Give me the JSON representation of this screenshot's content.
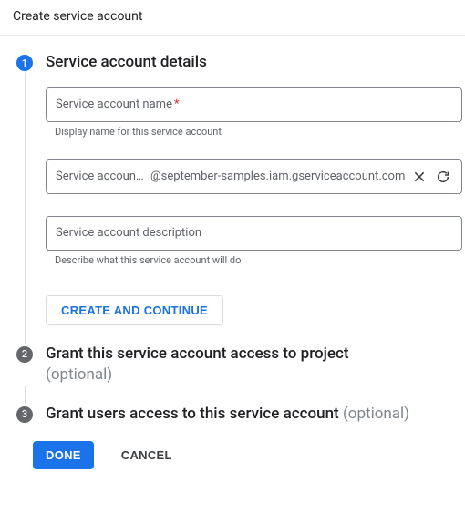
{
  "header": {
    "title": "Create service account"
  },
  "steps": {
    "s1": {
      "num": "1",
      "title": "Service account details",
      "name_field": {
        "label": "Service account name",
        "helper": "Display name for this service account"
      },
      "id_field": {
        "label": "Service account I...",
        "domain": "@september-samples.iam.gserviceaccount.com"
      },
      "desc_field": {
        "label": "Service account description",
        "helper": "Describe what this service account will do"
      },
      "create_btn": "CREATE AND CONTINUE"
    },
    "s2": {
      "num": "2",
      "title": "Grant this service account access to project",
      "optional": "(optional)"
    },
    "s3": {
      "num": "3",
      "title": "Grant users access to this service account",
      "optional": "(optional)"
    }
  },
  "footer": {
    "done": "DONE",
    "cancel": "CANCEL"
  }
}
